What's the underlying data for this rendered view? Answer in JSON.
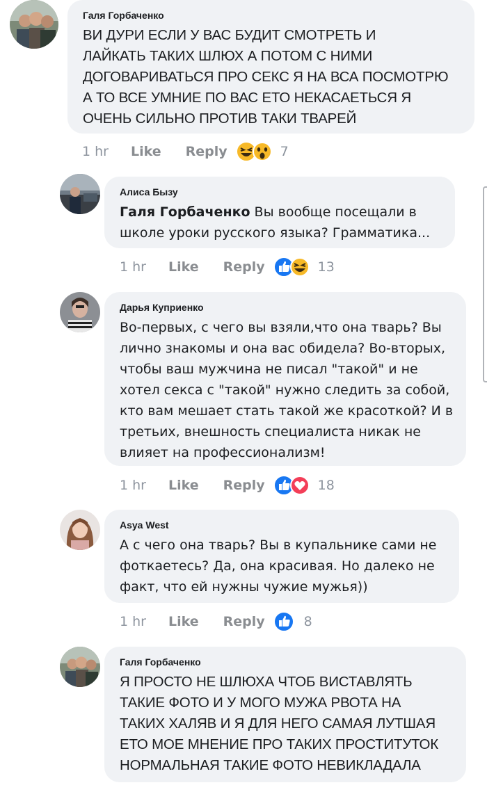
{
  "comments": [
    {
      "author": "Галя Горбаченко",
      "lines": [
        "ВИ ДУРИ ЕСЛИ У ВАС БУДИТ СМОТРЕТЬ И",
        "ЛАЙКАТЬ ТАКИХ ШЛЮХ А ПОТОМ С НИМИ",
        "ДОГОВАРИВАТЬСЯ ПРО СЕКС Я НА ВСА ПОСМОТРЮ",
        "А ТО ВСЕ УМНИЕ ПО ВАС ЕТО НЕКАСАЕТЬСЯ Я",
        "ОЧЕНЬ СИЛЬНО ПРОТИВ ТАКИ ТВАРЕЙ"
      ],
      "time": "1 hr",
      "like": "Like",
      "reply": "Reply",
      "reaction_count": "7",
      "reactions": [
        "haha-icon",
        "wow-icon"
      ]
    },
    {
      "author": "Алиса Бызу",
      "mention": "Галя Горбаченко",
      "lines": [
        " Вы вообще посещали в",
        "школе уроки русского языка? Грамматика..."
      ],
      "time": "1 hr",
      "like": "Like",
      "reply": "Reply",
      "reaction_count": "13",
      "reactions": [
        "like-icon",
        "haha-icon"
      ]
    },
    {
      "author": "Дарья Куприенко",
      "lines": [
        "Во-первых, с чего вы взяли,что она тварь? Вы",
        "лично знакомы и она вас обидела? Во-вторых,",
        "чтобы ваш мужчина не писал \"такой\" и не",
        "хотел секса с \"такой\" нужно следить за собой,",
        "кто вам мешает стать такой же красоткой? И в",
        "третьих, внешность специалиста никак не",
        "влияет на профессионализм!"
      ],
      "time": "1 hr",
      "like": "Like",
      "reply": "Reply",
      "reaction_count": "18",
      "reactions": [
        "like-icon",
        "love-icon"
      ]
    },
    {
      "author": "Asya West",
      "lines": [
        "А с чего она тварь? Вы в купальнике сами не",
        "фоткаетесь? Да, она красивая. Но далеко не",
        "факт, что ей нужны чужие мужья))"
      ],
      "time": "1 hr",
      "like": "Like",
      "reply": "Reply",
      "reaction_count": "8",
      "reactions": [
        "like-icon"
      ]
    },
    {
      "author": "Галя Горбаченко",
      "lines": [
        "Я ПРОСТО НЕ ШЛЮХА ЧТОБ ВИСТАВЛЯТЬ",
        "ТАКИЕ ФОТО И У МОГО МУЖА РВОТА НА",
        "ТАКИХ ХАЛЯВ И Я ДЛЯ НЕГО САМАЯ ЛУТШАЯ",
        "ЕТО МОЕ МНЕНИЕ ПРО ТАКИХ ПРОСТИТУТОК",
        "НОРМАЛЬНАЯ ТАКИЕ ФОТО НЕВИКЛАДАЛА"
      ]
    }
  ],
  "colors": {
    "bubble": "#f0f2f5",
    "text": "#1c1e21",
    "meta": "#8a8d91",
    "like_blue": "#1877f2",
    "love_red": "#f33e58",
    "haha_yellow": "#f7b928"
  }
}
